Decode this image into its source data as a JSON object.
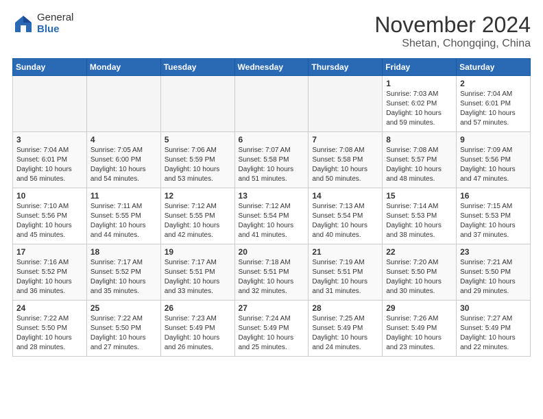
{
  "logo": {
    "general": "General",
    "blue": "Blue"
  },
  "title": "November 2024",
  "location": "Shetan, Chongqing, China",
  "days_of_week": [
    "Sunday",
    "Monday",
    "Tuesday",
    "Wednesday",
    "Thursday",
    "Friday",
    "Saturday"
  ],
  "weeks": [
    [
      {
        "day": "",
        "info": ""
      },
      {
        "day": "",
        "info": ""
      },
      {
        "day": "",
        "info": ""
      },
      {
        "day": "",
        "info": ""
      },
      {
        "day": "",
        "info": ""
      },
      {
        "day": "1",
        "info": "Sunrise: 7:03 AM\nSunset: 6:02 PM\nDaylight: 10 hours\nand 59 minutes."
      },
      {
        "day": "2",
        "info": "Sunrise: 7:04 AM\nSunset: 6:01 PM\nDaylight: 10 hours\nand 57 minutes."
      }
    ],
    [
      {
        "day": "3",
        "info": "Sunrise: 7:04 AM\nSunset: 6:01 PM\nDaylight: 10 hours\nand 56 minutes."
      },
      {
        "day": "4",
        "info": "Sunrise: 7:05 AM\nSunset: 6:00 PM\nDaylight: 10 hours\nand 54 minutes."
      },
      {
        "day": "5",
        "info": "Sunrise: 7:06 AM\nSunset: 5:59 PM\nDaylight: 10 hours\nand 53 minutes."
      },
      {
        "day": "6",
        "info": "Sunrise: 7:07 AM\nSunset: 5:58 PM\nDaylight: 10 hours\nand 51 minutes."
      },
      {
        "day": "7",
        "info": "Sunrise: 7:08 AM\nSunset: 5:58 PM\nDaylight: 10 hours\nand 50 minutes."
      },
      {
        "day": "8",
        "info": "Sunrise: 7:08 AM\nSunset: 5:57 PM\nDaylight: 10 hours\nand 48 minutes."
      },
      {
        "day": "9",
        "info": "Sunrise: 7:09 AM\nSunset: 5:56 PM\nDaylight: 10 hours\nand 47 minutes."
      }
    ],
    [
      {
        "day": "10",
        "info": "Sunrise: 7:10 AM\nSunset: 5:56 PM\nDaylight: 10 hours\nand 45 minutes."
      },
      {
        "day": "11",
        "info": "Sunrise: 7:11 AM\nSunset: 5:55 PM\nDaylight: 10 hours\nand 44 minutes."
      },
      {
        "day": "12",
        "info": "Sunrise: 7:12 AM\nSunset: 5:55 PM\nDaylight: 10 hours\nand 42 minutes."
      },
      {
        "day": "13",
        "info": "Sunrise: 7:12 AM\nSunset: 5:54 PM\nDaylight: 10 hours\nand 41 minutes."
      },
      {
        "day": "14",
        "info": "Sunrise: 7:13 AM\nSunset: 5:54 PM\nDaylight: 10 hours\nand 40 minutes."
      },
      {
        "day": "15",
        "info": "Sunrise: 7:14 AM\nSunset: 5:53 PM\nDaylight: 10 hours\nand 38 minutes."
      },
      {
        "day": "16",
        "info": "Sunrise: 7:15 AM\nSunset: 5:53 PM\nDaylight: 10 hours\nand 37 minutes."
      }
    ],
    [
      {
        "day": "17",
        "info": "Sunrise: 7:16 AM\nSunset: 5:52 PM\nDaylight: 10 hours\nand 36 minutes."
      },
      {
        "day": "18",
        "info": "Sunrise: 7:17 AM\nSunset: 5:52 PM\nDaylight: 10 hours\nand 35 minutes."
      },
      {
        "day": "19",
        "info": "Sunrise: 7:17 AM\nSunset: 5:51 PM\nDaylight: 10 hours\nand 33 minutes."
      },
      {
        "day": "20",
        "info": "Sunrise: 7:18 AM\nSunset: 5:51 PM\nDaylight: 10 hours\nand 32 minutes."
      },
      {
        "day": "21",
        "info": "Sunrise: 7:19 AM\nSunset: 5:51 PM\nDaylight: 10 hours\nand 31 minutes."
      },
      {
        "day": "22",
        "info": "Sunrise: 7:20 AM\nSunset: 5:50 PM\nDaylight: 10 hours\nand 30 minutes."
      },
      {
        "day": "23",
        "info": "Sunrise: 7:21 AM\nSunset: 5:50 PM\nDaylight: 10 hours\nand 29 minutes."
      }
    ],
    [
      {
        "day": "24",
        "info": "Sunrise: 7:22 AM\nSunset: 5:50 PM\nDaylight: 10 hours\nand 28 minutes."
      },
      {
        "day": "25",
        "info": "Sunrise: 7:22 AM\nSunset: 5:50 PM\nDaylight: 10 hours\nand 27 minutes."
      },
      {
        "day": "26",
        "info": "Sunrise: 7:23 AM\nSunset: 5:49 PM\nDaylight: 10 hours\nand 26 minutes."
      },
      {
        "day": "27",
        "info": "Sunrise: 7:24 AM\nSunset: 5:49 PM\nDaylight: 10 hours\nand 25 minutes."
      },
      {
        "day": "28",
        "info": "Sunrise: 7:25 AM\nSunset: 5:49 PM\nDaylight: 10 hours\nand 24 minutes."
      },
      {
        "day": "29",
        "info": "Sunrise: 7:26 AM\nSunset: 5:49 PM\nDaylight: 10 hours\nand 23 minutes."
      },
      {
        "day": "30",
        "info": "Sunrise: 7:27 AM\nSunset: 5:49 PM\nDaylight: 10 hours\nand 22 minutes."
      }
    ]
  ]
}
